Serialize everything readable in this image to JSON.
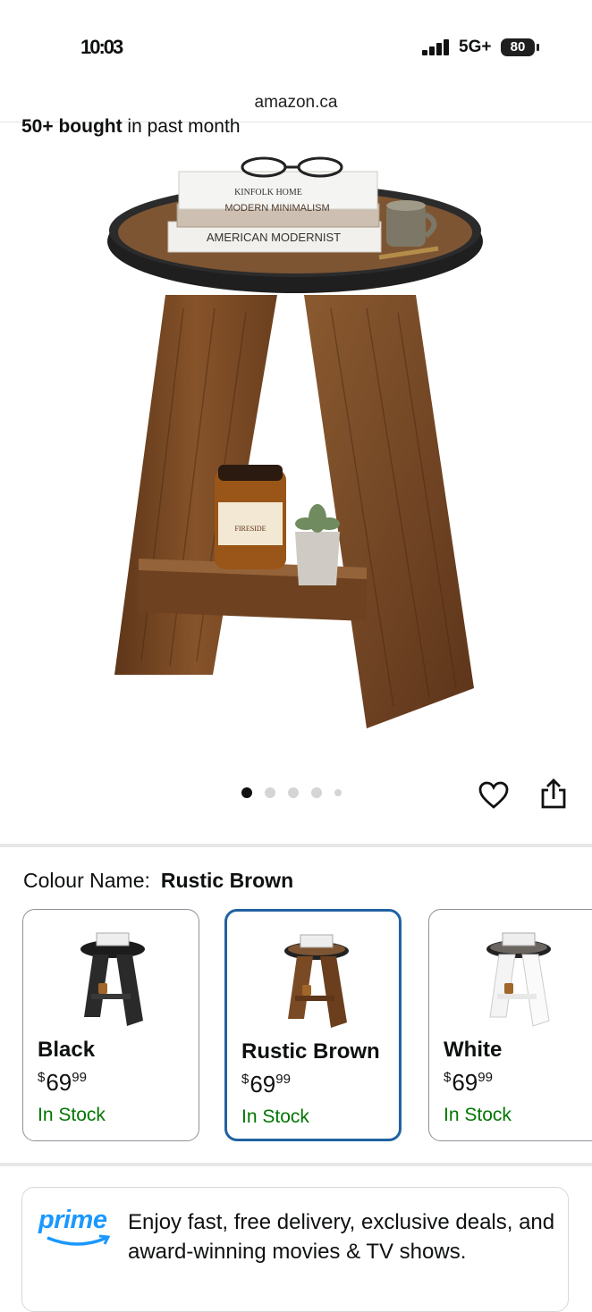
{
  "status_bar": {
    "time": "10:03",
    "network": "5G+",
    "battery": "80"
  },
  "browser": {
    "url": "amazon.ca"
  },
  "product": {
    "bought_bold": "50+ bought",
    "bought_rest": " in past month",
    "image_count": 5,
    "active_image": 0,
    "book_titles": [
      "KINFOLK HOME",
      "MODERN MINIMALISM",
      "AMERICAN MODERNIST"
    ],
    "candle_label": "FIRESIDE"
  },
  "colour": {
    "label": "Colour Name:",
    "selected": "Rustic Brown",
    "options": [
      {
        "name": "Black",
        "currency": "$",
        "price_whole": "69",
        "price_cents": "99",
        "stock": "In Stock"
      },
      {
        "name": "Rustic Brown",
        "currency": "$",
        "price_whole": "69",
        "price_cents": "99",
        "stock": "In Stock"
      },
      {
        "name": "White",
        "currency": "$",
        "price_whole": "69",
        "price_cents": "99",
        "stock": "In Stock"
      }
    ]
  },
  "prime": {
    "logo": "prime",
    "text": "Enjoy fast, free delivery, exclusive deals, and award-winning movies & TV shows."
  },
  "colors": {
    "accent_blue": "#2162a1",
    "in_stock": "#007600",
    "prime_blue": "#1a98ff",
    "wood": "#7a4a24"
  },
  "icons": [
    "heart-icon",
    "share-icon",
    "signal-icon",
    "battery-icon",
    "prime-smile-icon"
  ]
}
